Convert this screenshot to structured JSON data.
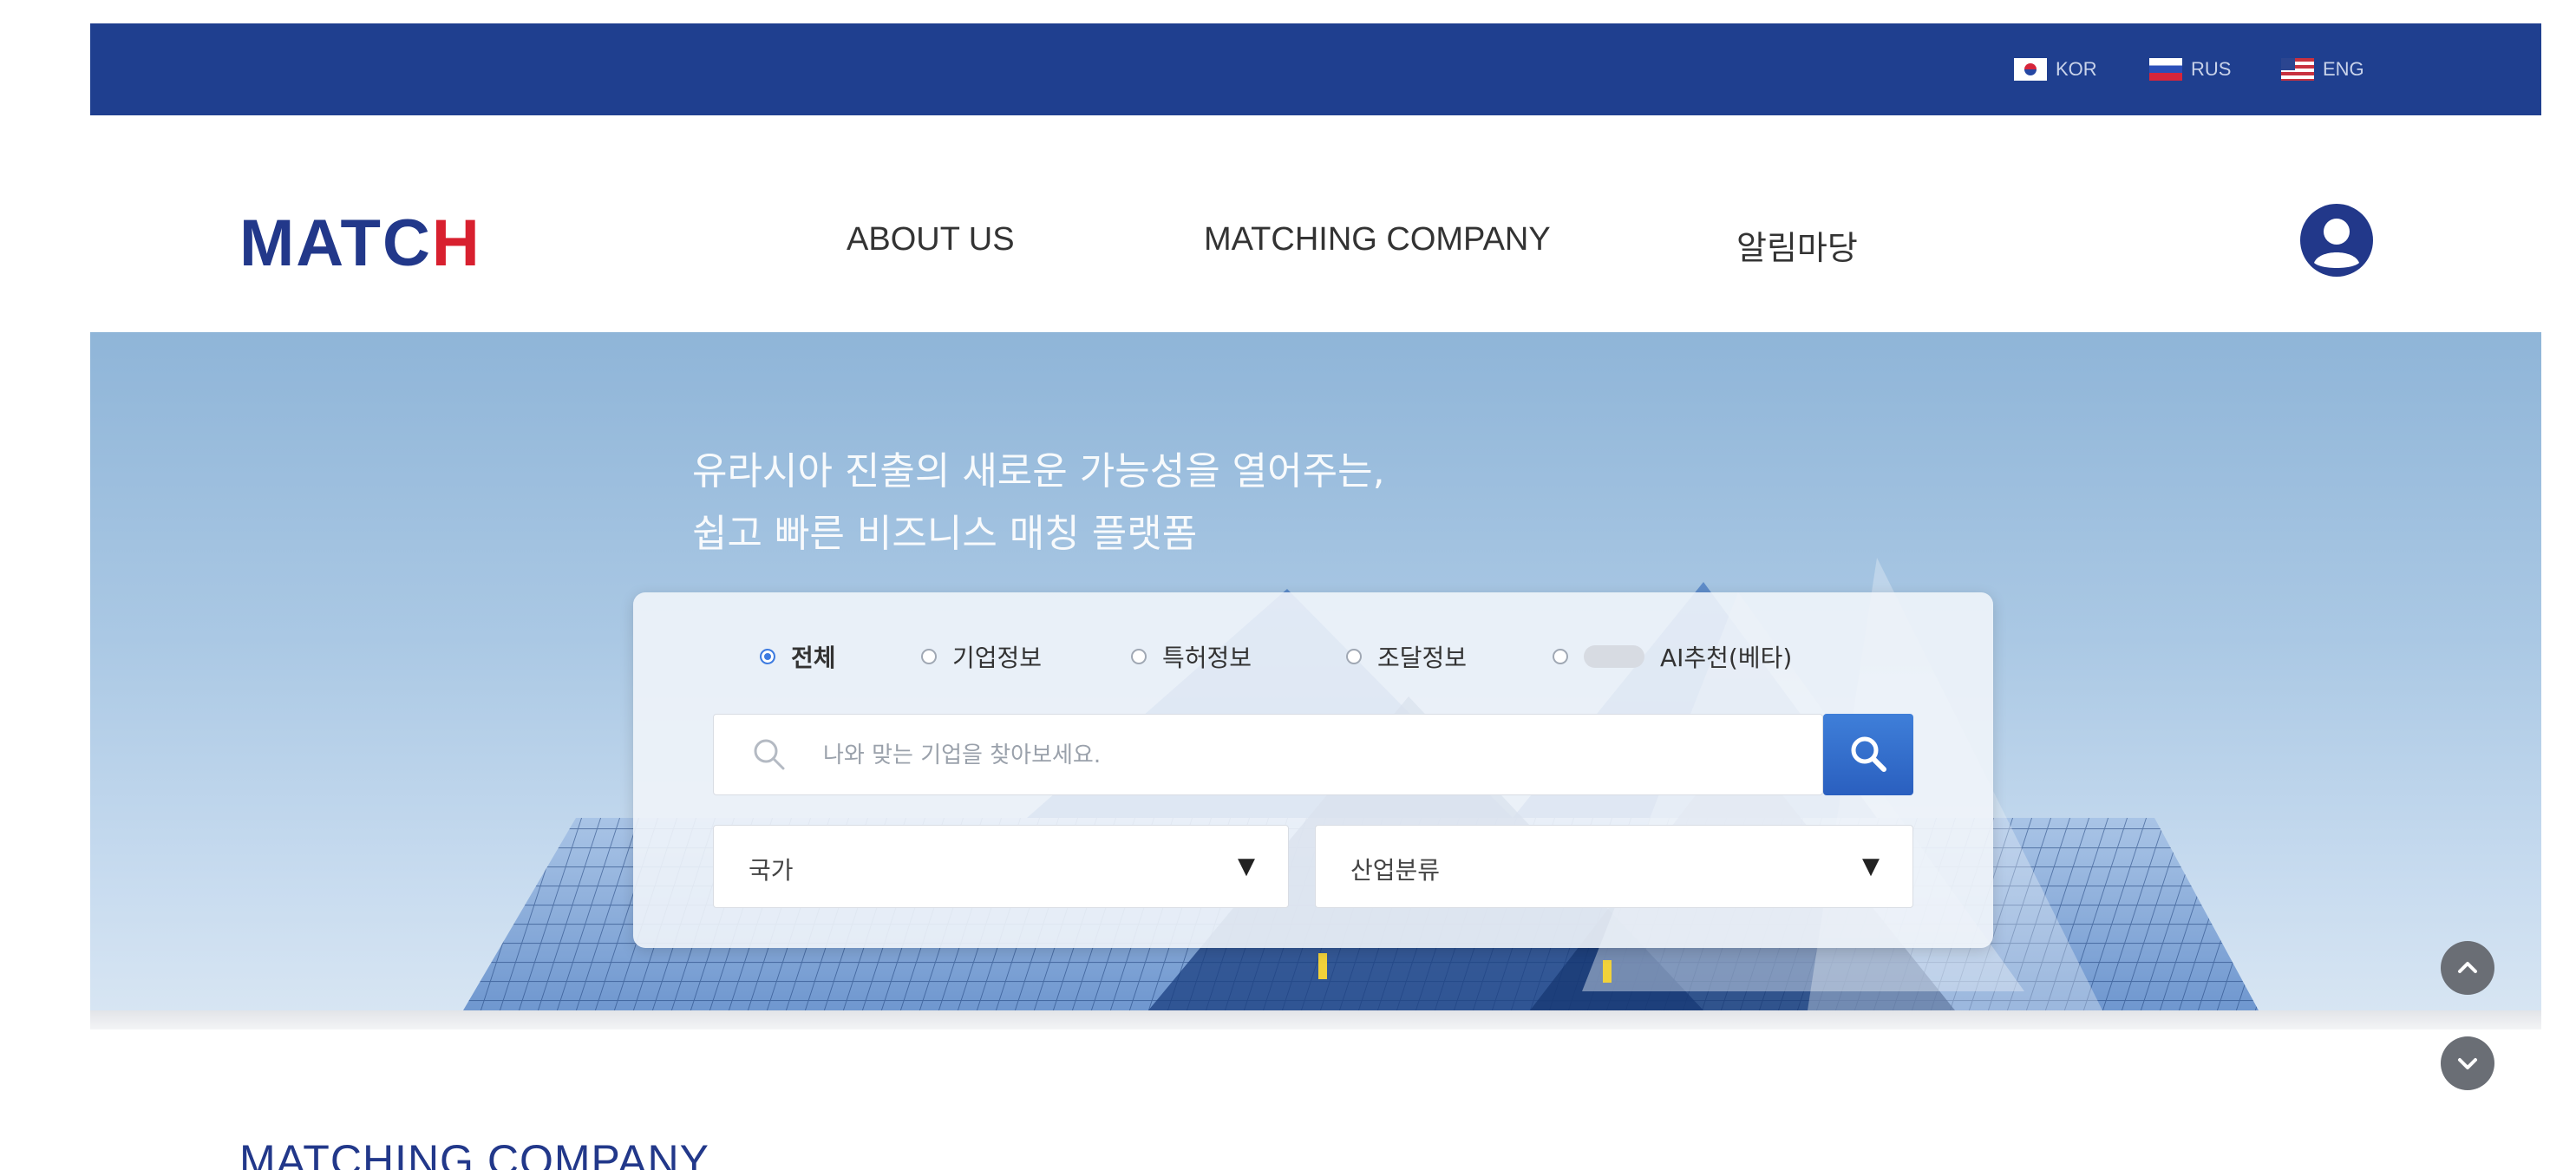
{
  "languages": [
    {
      "code": "KOR",
      "flag": "korea-flag-icon"
    },
    {
      "code": "RUS",
      "flag": "russia-flag-icon"
    },
    {
      "code": "ENG",
      "flag": "usa-flag-icon"
    }
  ],
  "header": {
    "logo_text": "MATC",
    "logo_accent": "H",
    "nav": [
      "ABOUT US",
      "MATCHING COMPANY",
      "알림마당"
    ],
    "user_icon": "user-circle-icon"
  },
  "hero": {
    "tagline_line1": "유라시아 진출의 새로운 가능성을 열어주는,",
    "tagline_line2": "쉽고 빠른 비즈니스 매칭 플랫폼",
    "filters": [
      {
        "label": "전체",
        "selected": true
      },
      {
        "label": "기업정보",
        "selected": false
      },
      {
        "label": "특허정보",
        "selected": false
      },
      {
        "label": "조달정보",
        "selected": false
      },
      {
        "label": "AI추천(베타)",
        "selected": false
      }
    ],
    "search": {
      "placeholder": "나와 맞는 기업을 찾아보세요.",
      "value": ""
    },
    "selects": {
      "country": "국가",
      "industry": "산업분류"
    }
  },
  "section": {
    "title": "MATCHING COMPANY"
  },
  "colors": {
    "top_bar": "#1f3f8f",
    "brand_blue": "#22388a",
    "brand_red": "#d8202f",
    "search_button": "#2a5fbf"
  }
}
